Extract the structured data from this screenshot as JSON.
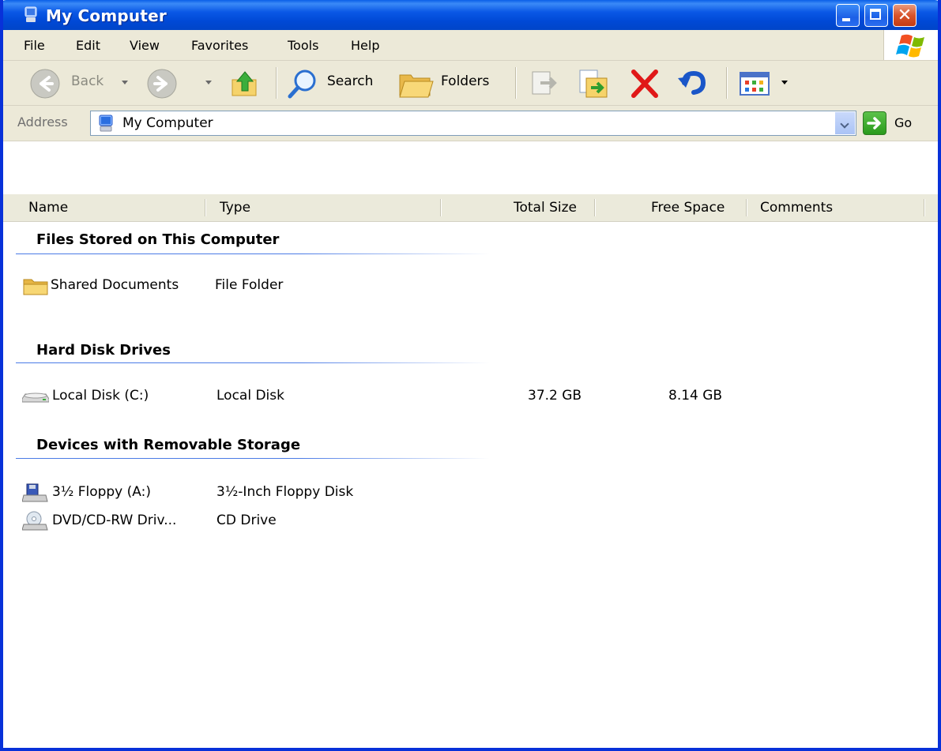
{
  "window": {
    "title": "My Computer"
  },
  "menu": [
    "File",
    "Edit",
    "View",
    "Favorites",
    "Tools",
    "Help"
  ],
  "toolbar": {
    "back_label": "Back",
    "search_label": "Search",
    "folders_label": "Folders"
  },
  "address": {
    "label": "Address",
    "value": "My Computer",
    "go_label": "Go"
  },
  "columns": [
    "Name",
    "Type",
    "Total Size",
    "Free Space",
    "Comments"
  ],
  "groups": [
    {
      "title": "Files Stored on This Computer",
      "items": [
        {
          "icon": "folder-icon",
          "name": "Shared Documents",
          "type": "File Folder",
          "total": "",
          "free": ""
        }
      ]
    },
    {
      "title": "Hard Disk Drives",
      "items": [
        {
          "icon": "hard-disk-icon",
          "name": "Local Disk (C:)",
          "type": "Local Disk",
          "total": "37.2 GB",
          "free": "8.14 GB"
        }
      ]
    },
    {
      "title": "Devices with Removable Storage",
      "items": [
        {
          "icon": "floppy-drive-icon",
          "name": "3½ Floppy (A:)",
          "type": "3½-Inch Floppy Disk",
          "total": "",
          "free": ""
        },
        {
          "icon": "cd-drive-icon",
          "name": "DVD/CD-RW Driv...",
          "type": "CD Drive",
          "total": "",
          "free": ""
        }
      ]
    }
  ],
  "colors": {
    "titlebar": "#0a58e6",
    "chrome": "#ece9d8",
    "group_line": "#4b7be6"
  }
}
